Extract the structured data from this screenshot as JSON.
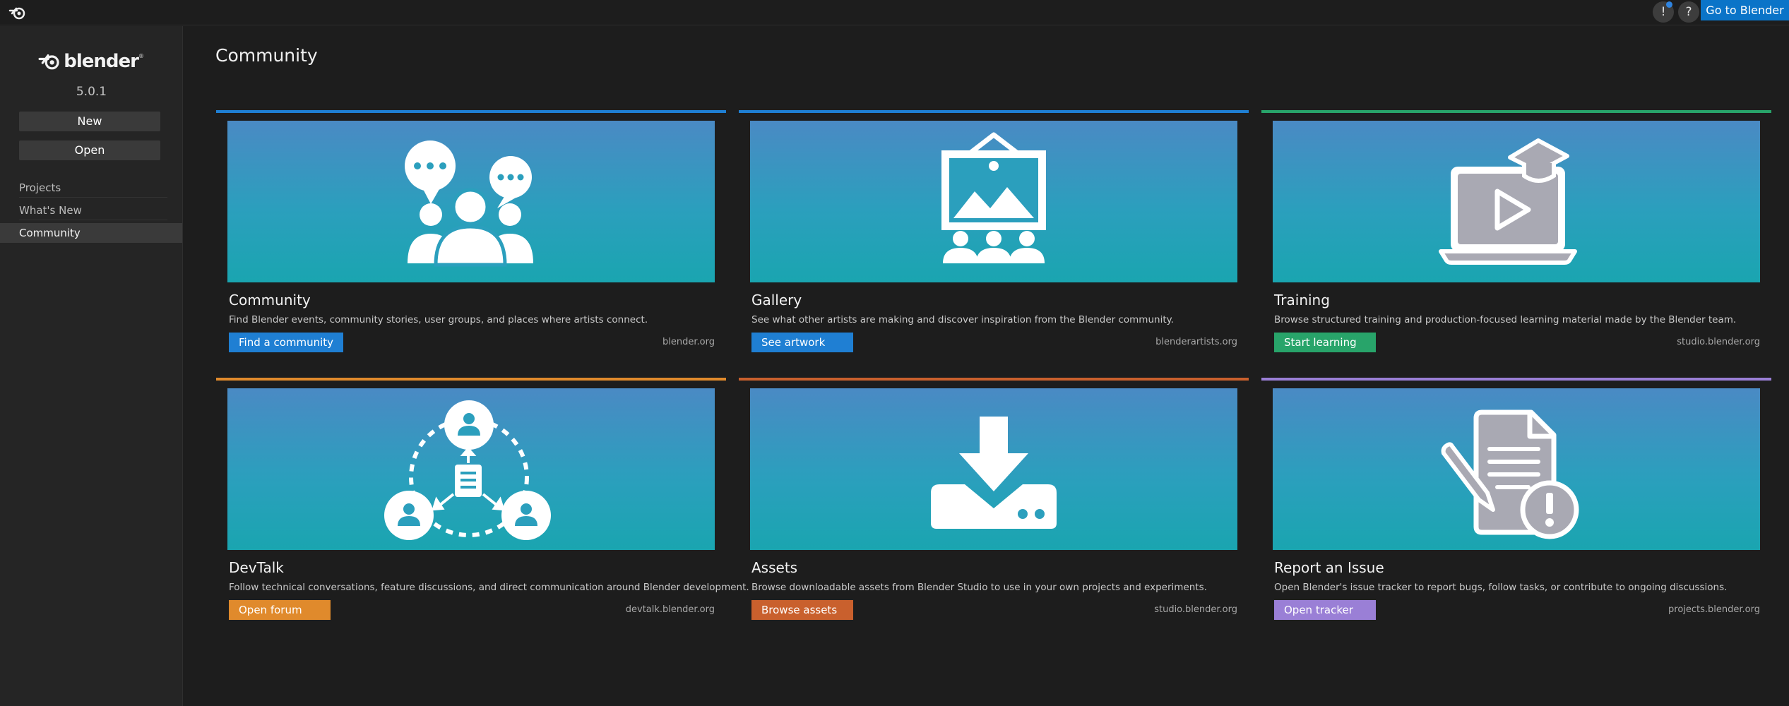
{
  "topbar": {
    "notifications_label": "!",
    "help_label": "?",
    "goto_label": "Go to Blender",
    "accent": "#0a74c8"
  },
  "sidebar": {
    "brand": "blender",
    "version": "5.0.1",
    "new_label": "New",
    "open_label": "Open",
    "items": [
      {
        "label": "Projects",
        "active": false
      },
      {
        "label": "What's New",
        "active": false
      },
      {
        "label": "Community",
        "active": true
      }
    ]
  },
  "main": {
    "title": "Community",
    "cards": [
      {
        "title": "Community",
        "description": "Find Blender events, community stories, user groups, and places where artists connect.",
        "button": "Find a community",
        "url": "blender.org",
        "accent": "#1f7fd3",
        "button_color": "#1f7fd3",
        "illustration": "community-icon"
      },
      {
        "title": "Gallery",
        "description": "See what other artists are making and discover inspiration from the Blender community.",
        "button": "See artwork",
        "url": "blenderartists.org",
        "accent": "#1f7fd3",
        "button_color": "#1f7fd3",
        "illustration": "gallery-icon"
      },
      {
        "title": "Training",
        "description": "Browse structured training and production-focused learning material made by the Blender team.",
        "button": "Start learning",
        "url": "studio.blender.org",
        "accent": "#28a46a",
        "button_color": "#28a46a",
        "illustration": "training-icon"
      },
      {
        "title": "DevTalk",
        "description": "Follow technical conversations, feature discussions, and direct communication around Blender development.",
        "button": "Open forum",
        "url": "devtalk.blender.org",
        "accent": "#e08a2c",
        "button_color": "#e08a2c",
        "illustration": "devtalk-icon"
      },
      {
        "title": "Assets",
        "description": "Browse downloadable assets from Blender Studio to use in your own projects and experiments.",
        "button": "Browse assets",
        "url": "studio.blender.org",
        "accent": "#c9602d",
        "button_color": "#c9602d",
        "illustration": "download-icon"
      },
      {
        "title": "Report an Issue",
        "description": "Open Blender's issue tracker to report bugs, follow tasks, or contribute to ongoing discussions.",
        "button": "Open tracker",
        "url": "projects.blender.org",
        "accent": "#9a7fd6",
        "button_color": "#9a7fd6",
        "illustration": "report-issue-icon"
      }
    ]
  }
}
